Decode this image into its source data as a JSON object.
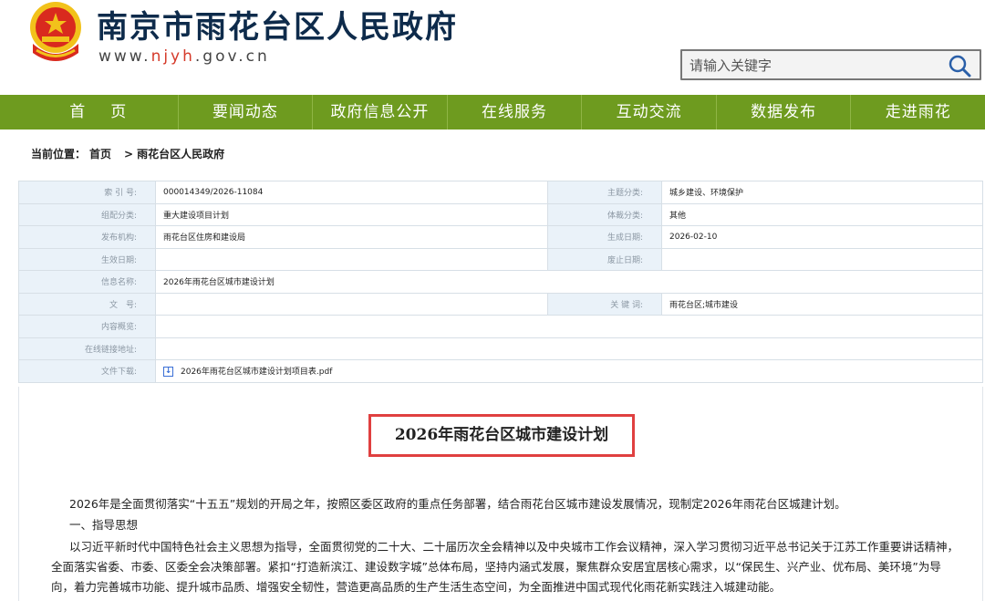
{
  "header": {
    "site_title": "南京市雨花台区人民政府",
    "url_prefix": "www.",
    "url_highlight": "njyh",
    "url_suffix": ".gov.cn",
    "search_placeholder": "请输入关键字"
  },
  "nav": {
    "items": [
      "首页",
      "要闻动态",
      "政府信息公开",
      "在线服务",
      "互动交流",
      "数据发布",
      "走进雨花"
    ]
  },
  "breadcrumb": {
    "label": "当前位置：",
    "home": "首页",
    "separator": ">",
    "current": "雨花台区人民政府"
  },
  "info": {
    "index_label": "索 引 号:",
    "index_value": "000014349/2026-11084",
    "topic_label": "主题分类:",
    "topic_value": "城乡建设、环境保护",
    "category_label": "组配分类:",
    "category_value": "重大建设项目计划",
    "genre_label": "体裁分类:",
    "genre_value": "其他",
    "publisher_label": "发布机构:",
    "publisher_value": "雨花台区住房和建设局",
    "created_label": "生成日期:",
    "created_value": "2026-02-10",
    "effective_label": "生效日期:",
    "effective_value": "",
    "abolished_label": "废止日期:",
    "abolished_value": "",
    "name_label": "信息名称:",
    "name_value": "2026年雨花台区城市建设计划",
    "docno_label": "文　号:",
    "docno_value": "",
    "keywords_label": "关 键 词:",
    "keywords_value": "雨花台区;城市建设",
    "summary_label": "内容概览:",
    "summary_value": "",
    "link_label": "在线链接地址:",
    "link_value": "",
    "download_label": "文件下载:",
    "download_value": "2026年雨花台区城市建设计划项目表.pdf"
  },
  "document": {
    "title": "2026年雨花台区城市建设计划",
    "para1": "2026年是全面贯彻落实“十五五”规划的开局之年，按照区委区政府的重点任务部署，结合雨花台区城市建设发展情况，现制定2026年雨花台区城建计划。",
    "para2": "一、指导思想",
    "para3": "以习近平新时代中国特色社会主义思想为指导，全面贯彻党的二十大、二十届历次全会精神以及中央城市工作会议精神，深入学习贯彻习近平总书记关于江苏工作重要讲话精神，全面落实省委、市委、区委全会决策部署。紧扣“打造新滨江、建设数字城”总体布局，坚持内涵式发展，聚焦群众安居宜居核心需求，以“保民生、兴产业、优布局、美环境”为导向，着力完善城市功能、提升城市品质、增强安全韧性，营造更高品质的生产生活生态空间，为全面推进中国式现代化雨花新实践注入城建动能。"
  },
  "colors": {
    "nav_green": "#6e9b1f",
    "title_navy": "#0e2b4b",
    "title_box_red": "#e04040",
    "label_bg": "#eaf2f9"
  }
}
